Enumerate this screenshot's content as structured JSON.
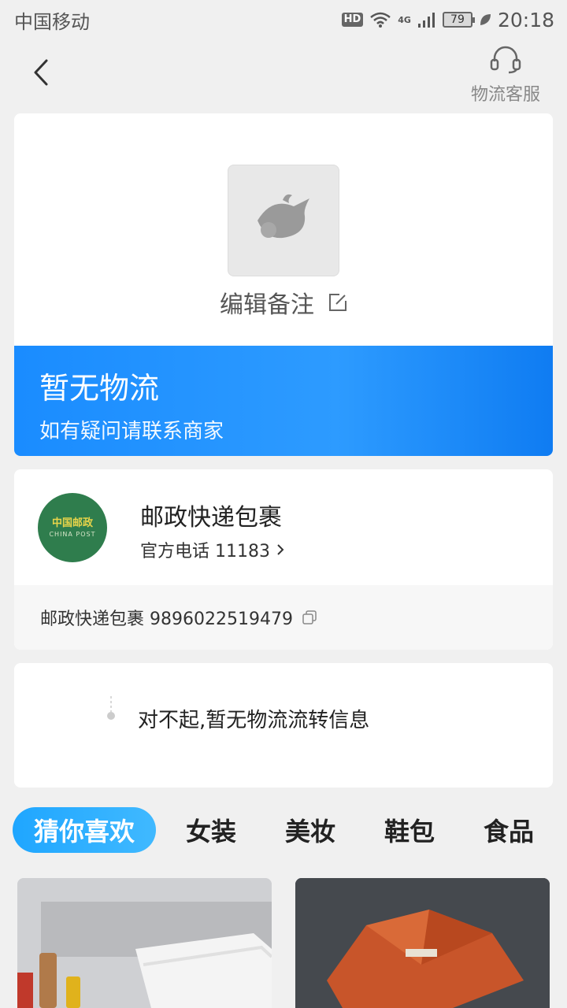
{
  "status_bar": {
    "carrier": "中国移动",
    "hd": "HD",
    "network": "4G",
    "battery": "79",
    "time": "20:18"
  },
  "nav": {
    "back_icon": "chevron-left-icon",
    "service_icon": "headset-icon",
    "service_label": "物流客服"
  },
  "package": {
    "note_label": "编辑备注",
    "edit_icon": "edit-icon"
  },
  "banner": {
    "title": "暂无物流",
    "subtitle": "如有疑问请联系商家",
    "color_start": "#1a8cff",
    "color_end": "#0f7cf2"
  },
  "courier": {
    "logo_text": "中国邮政",
    "logo_sub": "CHINA POST",
    "name": "邮政快递包裹",
    "phone_label": "官方电话 11183",
    "tracking_label": "邮政快递包裹 9896022519479"
  },
  "timeline": {
    "empty_message": "对不起,暂无物流流转信息"
  },
  "tabs": [
    {
      "label": "猜你喜欢",
      "active": true
    },
    {
      "label": "女装",
      "active": false
    },
    {
      "label": "美妆",
      "active": false
    },
    {
      "label": "鞋包",
      "active": false
    },
    {
      "label": "食品",
      "active": false
    }
  ],
  "accent_color": "#1fa6ff"
}
